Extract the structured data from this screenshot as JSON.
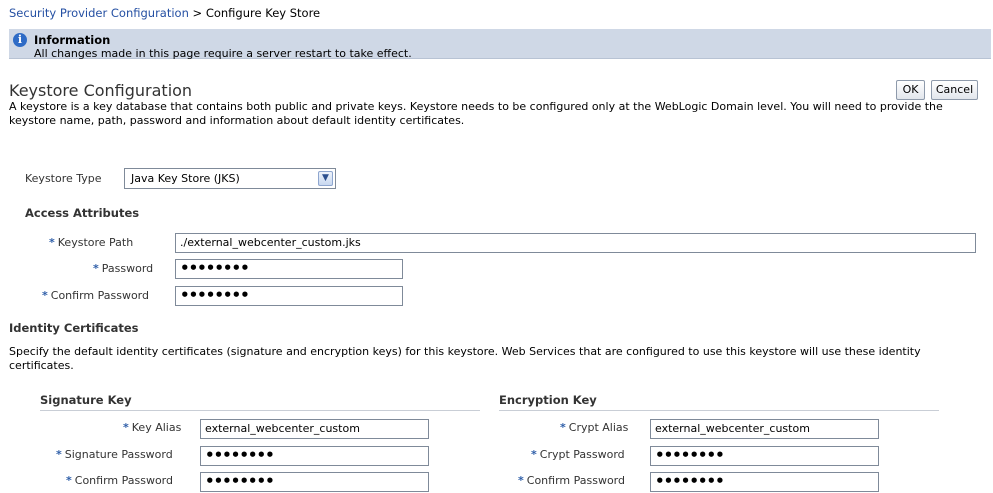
{
  "breadcrumb": {
    "parent": "Security Provider Configuration",
    "separator": ">",
    "current": "Configure Key Store"
  },
  "info": {
    "icon": "info-icon",
    "title": "Information",
    "message": "All changes made in this page require a server restart to take effect."
  },
  "page": {
    "title": "Keystore Configuration",
    "description": "A keystore is a key database that contains both public and private keys. Keystore needs to be configured only at the WebLogic Domain level. You will need to provide the keystore name, path, password and information about default identity certificates."
  },
  "actions": {
    "ok": "OK",
    "cancel": "Cancel"
  },
  "keystore_type": {
    "label": "Keystore Type",
    "value": "Java Key Store (JKS)"
  },
  "access": {
    "heading": "Access Attributes",
    "path_label": "Keystore Path",
    "path_value": "./external_webcenter_custom.jks",
    "password_label": "Password",
    "password_value": "••••••••",
    "confirm_label": "Confirm Password",
    "confirm_value": "••••••••"
  },
  "identity": {
    "heading": "Identity Certificates",
    "description": "Specify the default identity certificates (signature and encryption keys) for this keystore. Web Services that are configured to use this keystore will use these identity certificates."
  },
  "signature": {
    "heading": "Signature Key",
    "alias_label": "Key Alias",
    "alias_value": "external_webcenter_custom",
    "password_label": "Signature Password",
    "password_value": "••••••••",
    "confirm_label": "Confirm Password",
    "confirm_value": "••••••••"
  },
  "encryption": {
    "heading": "Encryption Key",
    "alias_label": "Crypt Alias",
    "alias_value": "external_webcenter_custom",
    "password_label": "Crypt Password",
    "password_value": "••••••••",
    "confirm_label": "Confirm Password",
    "confirm_value": "••••••••"
  },
  "required_marker": "*",
  "colors": {
    "link": "#2550a3",
    "info_bg": "#cfd8e6",
    "required": "#2e5ea8"
  }
}
